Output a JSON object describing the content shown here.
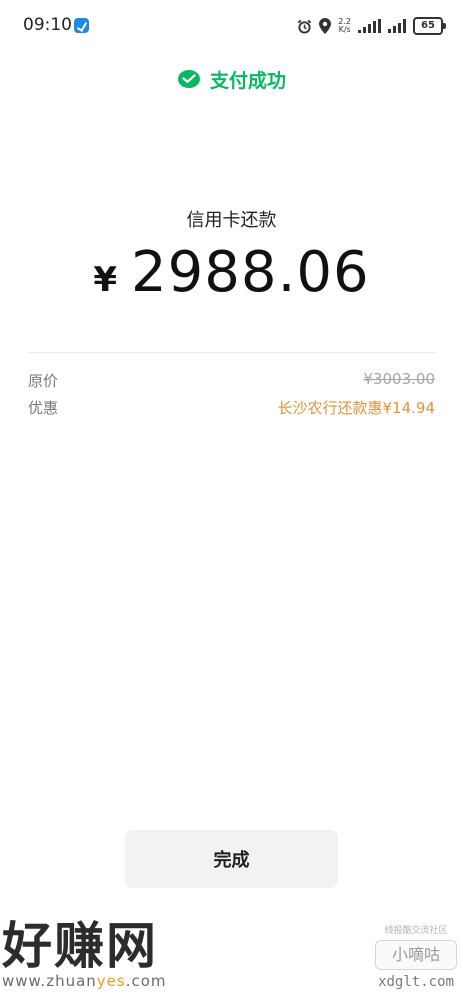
{
  "status_bar": {
    "time": "09:10",
    "net_speed_value": "2.2",
    "net_speed_unit": "K/s",
    "battery": "65",
    "icons": [
      "app-notification-icon",
      "alarm-icon",
      "location-icon",
      "signal-icon",
      "battery-icon"
    ]
  },
  "header": {
    "icon": "wechat-pay-icon",
    "title": "支付成功",
    "accent_color": "#07b862"
  },
  "payment": {
    "merchant": "信用卡还款",
    "currency_symbol": "¥",
    "amount": "2988.06"
  },
  "details": [
    {
      "label": "原价",
      "value": "¥3003.00",
      "style": "strikethrough"
    },
    {
      "label": "优惠",
      "value": "长沙农行还款惠¥14.94",
      "color": "#e2943a"
    }
  ],
  "done_button": {
    "label": "完成"
  },
  "watermarks": {
    "left_title": "好赚网",
    "left_url_before": "www.zhuan",
    "left_url_highlight": "yes",
    "left_url_after": ".com",
    "right_small": "线报酷交流社区",
    "right_logo": "小嘀咕",
    "right_domain": "xdglt.com"
  }
}
